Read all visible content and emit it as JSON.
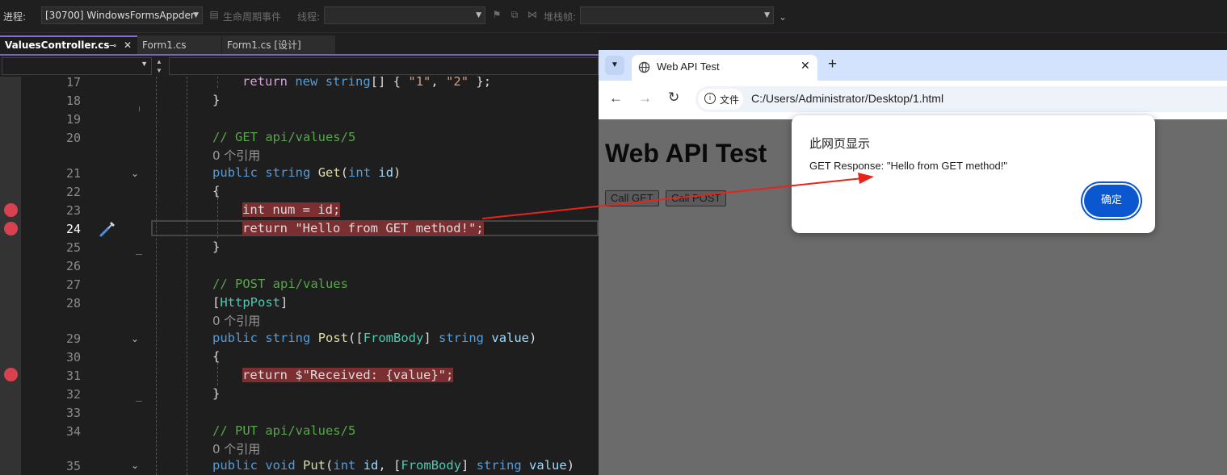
{
  "toolbar": {
    "process_label": "进程:",
    "process_value": "[30700] WindowsFormsAppder",
    "lifecycle_label": "生命周期事件",
    "thread_label": "线程:",
    "thread_value": "",
    "stackframe_label": "堆栈帧:",
    "stackframe_value": ""
  },
  "doc_tabs": [
    {
      "label": "ValuesController.cs",
      "pin": "⊸",
      "close": "✕"
    },
    {
      "label": "Form1.cs"
    },
    {
      "label": "Form1.cs [设计]"
    }
  ],
  "editor": {
    "lines": {
      "l17": "17",
      "l18": "18",
      "l19": "19",
      "l20": "20",
      "l21": "21",
      "l22": "22",
      "l23": "23",
      "l24": "24",
      "l25": "25",
      "l26": "26",
      "l27": "27",
      "l28": "28",
      "l29": "29",
      "l30": "30",
      "l31": "31",
      "l32": "32",
      "l33": "33",
      "l34": "34",
      "l35": "35"
    },
    "code": {
      "l17_return": "return",
      "l17_new": "new",
      "l17_string": "string",
      "l17_rest": "[] { ",
      "l17_s1": "\"1\"",
      "l17_comma": ", ",
      "l17_s2": "\"2\"",
      "l17_end": " };",
      "l18": "}",
      "l20_comment": "// GET api/values/5",
      "lens1": "0 个引用",
      "l21_public": "public",
      "l21_string": "string",
      "l21_get": "Get",
      "l21_open": "(",
      "l21_int": "int",
      "l21_id": "id",
      "l21_close": ")",
      "l22": "{",
      "l23_int": "int",
      "l23_rest": " num = id;",
      "l24_return": "return",
      "l24_str": "\"Hello from GET method!\"",
      "l24_semi": ";",
      "l25": "}",
      "l27_comment": "// POST api/values",
      "l28_open": "[",
      "l28_attr": "HttpPost",
      "l28_close": "]",
      "lens2": "0 个引用",
      "l29_public": "public",
      "l29_string": "string",
      "l29_post": "Post",
      "l29_p1": "([",
      "l29_frombody": "FromBody",
      "l29_p2": "] ",
      "l29_string2": "string",
      "l29_value": "value",
      "l29_p3": ")",
      "l30": "{",
      "l31_return": "return",
      "l31_str": "$\"Received: {value}\"",
      "l31_semi": ";",
      "l32": "}",
      "l34_comment": "// PUT api/values/5",
      "lens3": "0 个引用",
      "l35_public": "public",
      "l35_void": "void",
      "l35_put": "Put",
      "l35_p1": "(",
      "l35_int": "int",
      "l35_id": "id",
      "l35_p2": ", [",
      "l35_frombody": "FromBody",
      "l35_p3": "] ",
      "l35_string": "string",
      "l35_value": "value",
      "l35_p4": ")"
    }
  },
  "browser": {
    "tab_title": "Web API Test",
    "address_chip": "文件",
    "url": "C:/Users/Administrator/Desktop/1.html",
    "page_heading": "Web API Test",
    "btn_get": "Call GET",
    "btn_post": "Call POST"
  },
  "dialog": {
    "title": "此网页显示",
    "message": "GET Response: \"Hello from GET method!\"",
    "ok_label": "确定"
  },
  "colors": {
    "breakpoint": "#d84150",
    "breakpoint_highlight": "#7b2f31",
    "dialog_button": "#0b57d0",
    "annotation_arrow": "#e8231a"
  }
}
